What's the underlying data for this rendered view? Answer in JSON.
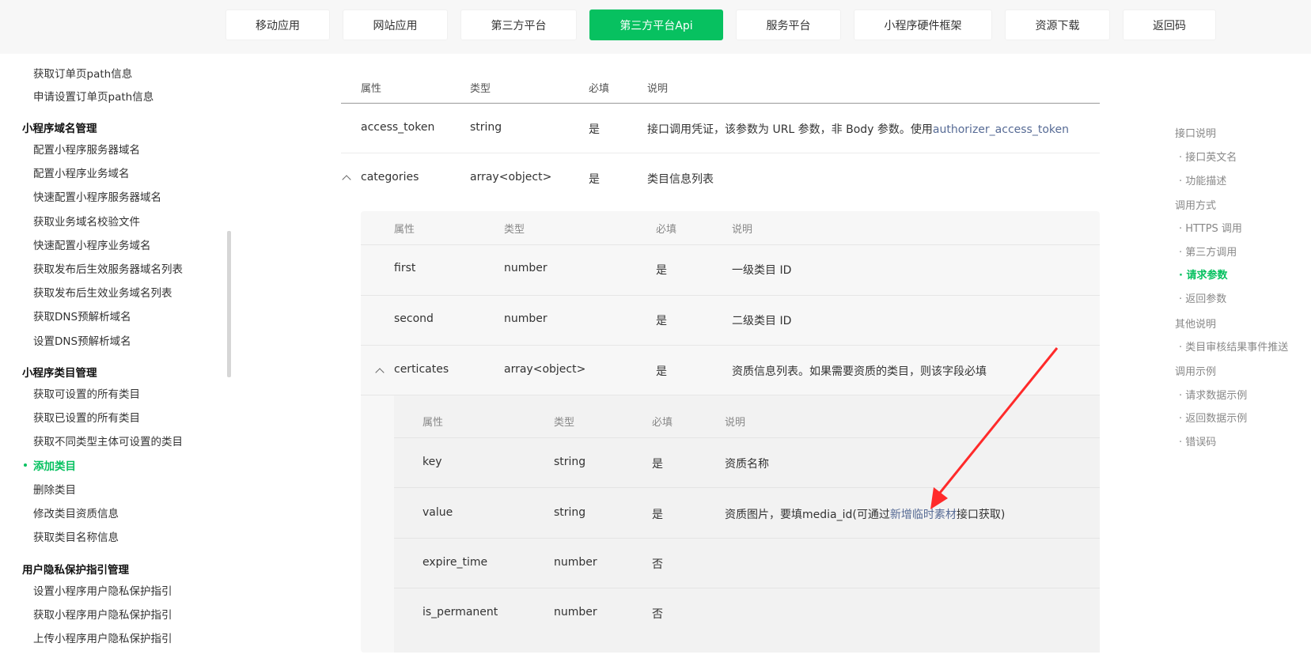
{
  "nav": {
    "items": [
      "移动应用",
      "网站应用",
      "第三方平台",
      "第三方平台Api",
      "服务平台",
      "小程序硬件框架",
      "资源下载",
      "返回码"
    ],
    "active_index": 3
  },
  "sidebar": {
    "items": [
      {
        "label": "获取订单页path信息",
        "type": "item"
      },
      {
        "label": "申请设置订单页path信息",
        "type": "item"
      },
      {
        "label": "小程序域名管理",
        "type": "group"
      },
      {
        "label": "配置小程序服务器域名",
        "type": "item"
      },
      {
        "label": "配置小程序业务域名",
        "type": "item"
      },
      {
        "label": "快速配置小程序服务器域名",
        "type": "item"
      },
      {
        "label": "获取业务域名校验文件",
        "type": "item"
      },
      {
        "label": "快速配置小程序业务域名",
        "type": "item"
      },
      {
        "label": "获取发布后生效服务器域名列表",
        "type": "item"
      },
      {
        "label": "获取发布后生效业务域名列表",
        "type": "item"
      },
      {
        "label": "获取DNS预解析域名",
        "type": "item"
      },
      {
        "label": "设置DNS预解析域名",
        "type": "item"
      },
      {
        "label": "小程序类目管理",
        "type": "group"
      },
      {
        "label": "获取可设置的所有类目",
        "type": "item"
      },
      {
        "label": "获取已设置的所有类目",
        "type": "item"
      },
      {
        "label": "获取不同类型主体可设置的类目",
        "type": "item"
      },
      {
        "label": "添加类目",
        "type": "active"
      },
      {
        "label": "删除类目",
        "type": "item"
      },
      {
        "label": "修改类目资质信息",
        "type": "item"
      },
      {
        "label": "获取类目名称信息",
        "type": "item"
      },
      {
        "label": "用户隐私保护指引管理",
        "type": "group"
      },
      {
        "label": "设置小程序用户隐私保护指引",
        "type": "item"
      },
      {
        "label": "获取小程序用户隐私保护指引",
        "type": "item"
      },
      {
        "label": "上传小程序用户隐私保护指引",
        "type": "item"
      }
    ]
  },
  "table": {
    "headers": [
      "属性",
      "类型",
      "必填",
      "说明"
    ],
    "rows": [
      {
        "name": "access_token",
        "type": "string",
        "required": "是",
        "desc": "接口调用凭证，该参数为 URL 参数，非 Body 参数。使用",
        "link": "authorizer_access_token"
      },
      {
        "name": "categories",
        "type": "array<object>",
        "required": "是",
        "desc": "类目信息列表"
      }
    ],
    "nested": {
      "headers": [
        "属性",
        "类型",
        "必填",
        "说明"
      ],
      "rows": [
        {
          "name": "first",
          "type": "number",
          "required": "是",
          "desc": "一级类目 ID"
        },
        {
          "name": "second",
          "type": "number",
          "required": "是",
          "desc": "二级类目 ID"
        },
        {
          "name": "certicates",
          "type": "array<object>",
          "required": "是",
          "desc": "资质信息列表。如果需要资质的类目，则该字段必填"
        }
      ],
      "nested": {
        "headers": [
          "属性",
          "类型",
          "必填",
          "说明"
        ],
        "rows": [
          {
            "name": "key",
            "type": "string",
            "required": "是",
            "desc": "资质名称"
          },
          {
            "name": "value",
            "type": "string",
            "required": "是",
            "desc_pre": "资质图片，要填media_id(可通过",
            "link": "新增临时素材",
            "desc_post": "接口获取)"
          },
          {
            "name": "expire_time",
            "type": "number",
            "required": "否",
            "desc": ""
          },
          {
            "name": "is_permanent",
            "type": "number",
            "required": "否",
            "desc": ""
          }
        ]
      }
    }
  },
  "toc": {
    "items": [
      {
        "label": "接口说明",
        "type": "head"
      },
      {
        "label": "· 接口英文名",
        "type": "item"
      },
      {
        "label": "· 功能描述",
        "type": "item"
      },
      {
        "label": "调用方式",
        "type": "head"
      },
      {
        "label": "· HTTPS 调用",
        "type": "item"
      },
      {
        "label": "· 第三方调用",
        "type": "item"
      },
      {
        "label": "· 请求参数",
        "type": "active"
      },
      {
        "label": "· 返回参数",
        "type": "item"
      },
      {
        "label": "其他说明",
        "type": "head"
      },
      {
        "label": "· 类目审核结果事件推送",
        "type": "item"
      },
      {
        "label": "调用示例",
        "type": "head"
      },
      {
        "label": "· 请求数据示例",
        "type": "item"
      },
      {
        "label": "· 返回数据示例",
        "type": "item"
      },
      {
        "label": "· 错误码",
        "type": "item"
      }
    ]
  },
  "colors": {
    "accent": "#07c160",
    "link": "#576b95",
    "annotation_arrow": "#ff2a2a"
  }
}
